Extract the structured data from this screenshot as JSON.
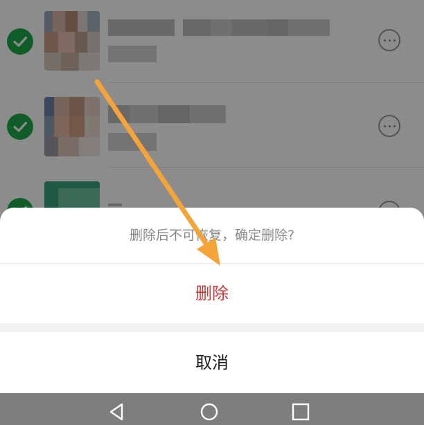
{
  "dialog": {
    "message": "删除后不可恢复，确定删除?",
    "delete_label": "删除",
    "cancel_label": "取消"
  },
  "list": {
    "rows": [
      {
        "checked": true,
        "icon": "check-circle-icon",
        "menu_icon": "more-icon"
      },
      {
        "checked": true,
        "icon": "check-circle-icon",
        "menu_icon": "more-icon"
      },
      {
        "checked": true,
        "icon": "check-circle-icon",
        "menu_icon": "more-icon"
      }
    ]
  },
  "nav_bar": {
    "icons": [
      "back-icon",
      "home-icon",
      "recents-icon"
    ]
  },
  "annotation": {
    "icon": "orange-arrow-icon",
    "color": "#f5a43a"
  },
  "colors": {
    "accent_green": "#1faa4b",
    "destructive_red": "#c8393a"
  }
}
